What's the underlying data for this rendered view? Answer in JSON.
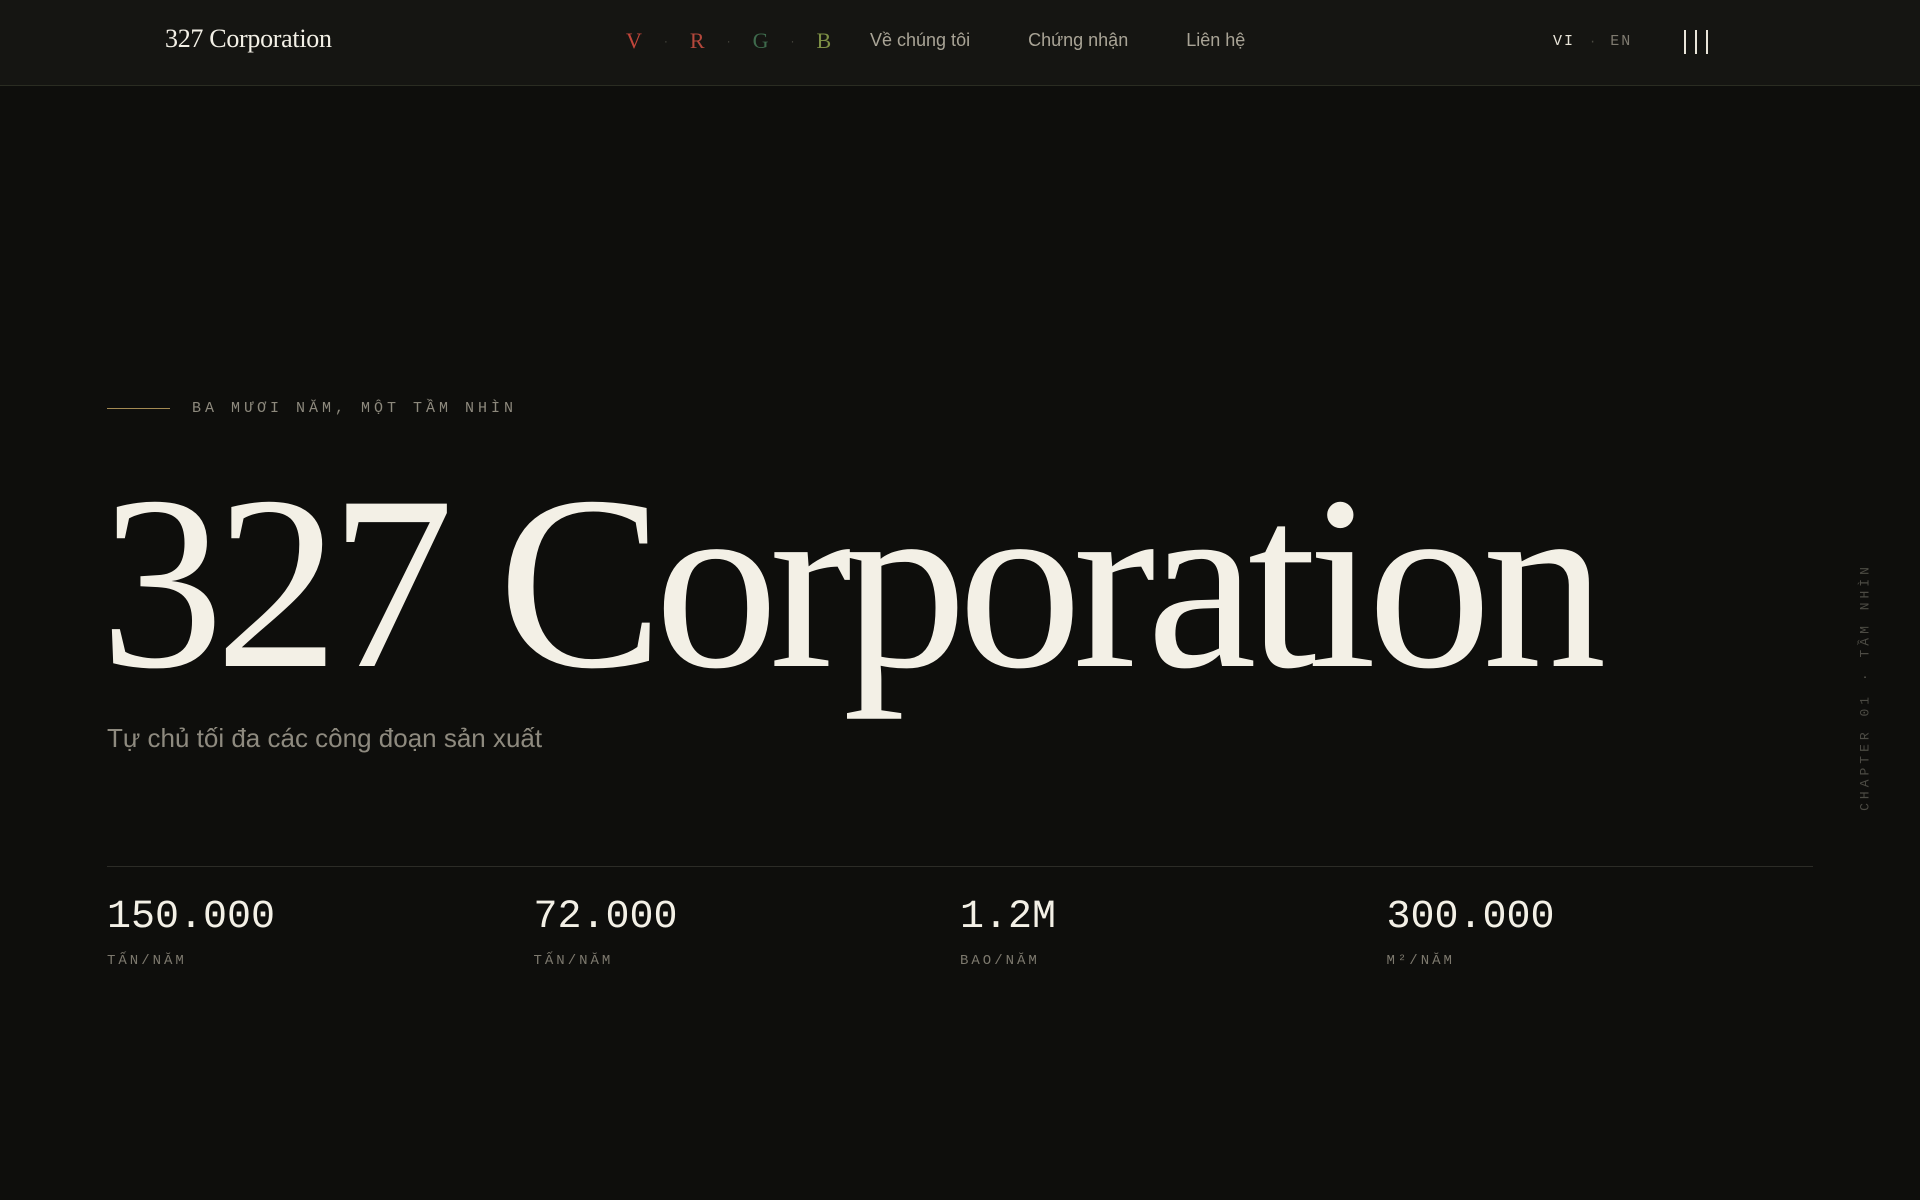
{
  "header": {
    "logo": "327 Corporation",
    "brands": [
      {
        "letter": "V",
        "color": "#c0453a"
      },
      {
        "letter": "R",
        "color": "#b5483c"
      },
      {
        "letter": "G",
        "color": "#3e6a4c"
      },
      {
        "letter": "B",
        "color": "#7d8f45"
      }
    ],
    "brand_separator": "·",
    "nav": [
      {
        "label": "Về chúng tôi"
      },
      {
        "label": "Chứng nhận"
      },
      {
        "label": "Liên hệ"
      }
    ],
    "lang": {
      "active": "VI",
      "separator": "·",
      "other": "EN"
    },
    "menu_icon": "menu-bars-icon"
  },
  "hero": {
    "eyebrow": "BA MƯƠI NĂM, MỘT TẦM NHÌN",
    "title": "327 Corporation",
    "subtitle": "Tự chủ tối đa các công đoạn sản xuất"
  },
  "stats": [
    {
      "value": "150.000",
      "label": "TẤN/NĂM"
    },
    {
      "value": "72.000",
      "label": "TẤN/NĂM"
    },
    {
      "value": "1.2M",
      "label": "BAO/NĂM"
    },
    {
      "value": "300.000",
      "label": "M²/NĂM"
    }
  ],
  "side_label": "CHAPTER 01 · TẦM NHÌN",
  "colors": {
    "background": "#0e0e0c",
    "header_background": "#151512",
    "text_primary": "#f3f0e6",
    "accent_line": "#a48a53"
  }
}
